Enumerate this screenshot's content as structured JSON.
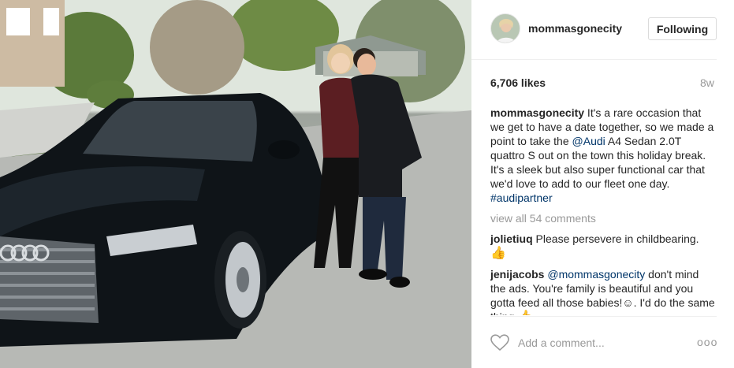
{
  "post": {
    "username": "mommasgonecity",
    "follow_label": "Following",
    "likes": "6,706 likes",
    "age": "8w"
  },
  "caption": {
    "user": "mommasgonecity",
    "text_1": " It's a rare occasion that we get to have a date together, so we made a point to take the ",
    "mention": "@Audi",
    "text_2": " A4 Sedan 2.0T quattro S out on the town this holiday break. It's a sleek but also super functional car that we'd love to add to our fleet one day. ",
    "hashtag": "#audipartner"
  },
  "view_all": "view all 54 comments",
  "comments": [
    {
      "user": "jolietiuq",
      "text": " Please persevere in childbearing. ",
      "emoji": "👍"
    },
    {
      "user": "jenijacobs",
      "mention": "@mommasgonecity",
      "text": " don't mind the ads. You're family is beautiful and you gotta feed all those babies!☺. I'd do the same thing ",
      "emoji": "👍"
    }
  ],
  "footer": {
    "placeholder": "Add a comment...",
    "more": "ooo"
  },
  "photo": {
    "car_plate_logo": "Audi rings"
  },
  "colors": {
    "link": "#003569",
    "muted": "#999999",
    "border": "#efefef"
  }
}
